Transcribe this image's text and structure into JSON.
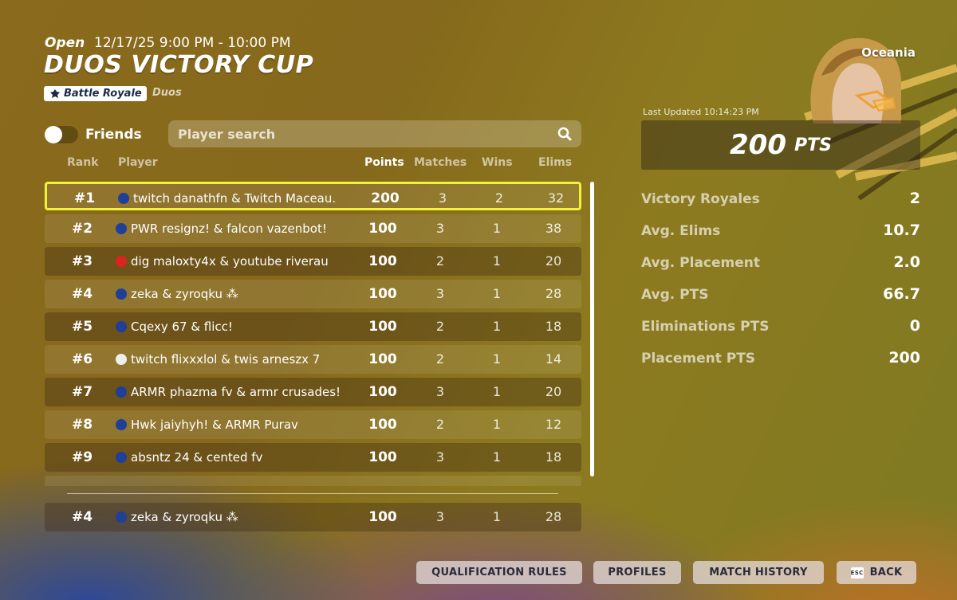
{
  "header": {
    "status": "Open",
    "time": "12/17/25 9:00 PM - 10:00 PM",
    "title": "DUOS VICTORY CUP",
    "mode": "Battle Royale",
    "team_type": "Duos"
  },
  "controls": {
    "friends_label": "Friends",
    "friends_toggle_on": false,
    "search_placeholder": "Player search"
  },
  "columns": {
    "rank": "Rank",
    "player": "Player",
    "points": "Points",
    "matches": "Matches",
    "wins": "Wins",
    "elims": "Elims"
  },
  "leaderboard": [
    {
      "rank": "#1",
      "player": "twitch danathfn & Twitch Maceau.",
      "flags": [
        "#1e3f9a",
        "#2a9d8f"
      ],
      "points": "200",
      "matches": "3",
      "wins": "2",
      "elims": "32"
    },
    {
      "rank": "#2",
      "player": "PWR resignz! & falcon vazenbot!",
      "flags": [
        "#1e3f9a",
        "#f2c200"
      ],
      "points": "100",
      "matches": "3",
      "wins": "1",
      "elims": "38"
    },
    {
      "rank": "#3",
      "player": "dig maloxty4x & youtube riverau",
      "flags": [
        "#d22",
        "#1e3f9a"
      ],
      "points": "100",
      "matches": "2",
      "wins": "1",
      "elims": "20"
    },
    {
      "rank": "#4",
      "player": "zeka & zyroqku ⁂",
      "flags": [
        "#1e3f9a",
        "#1e3f9a"
      ],
      "points": "100",
      "matches": "3",
      "wins": "1",
      "elims": "28"
    },
    {
      "rank": "#5",
      "player": "Cqexy 67 & flicc!",
      "flags": [
        "#1e3f9a",
        "#eee"
      ],
      "points": "100",
      "matches": "2",
      "wins": "1",
      "elims": "18"
    },
    {
      "rank": "#6",
      "player": "twitch flixxxlol & twis arneszx 7",
      "flags": [
        "#eee",
        "#e8b400"
      ],
      "points": "100",
      "matches": "2",
      "wins": "1",
      "elims": "14"
    },
    {
      "rank": "#7",
      "player": "ARMR phazma fv & armr crusades!",
      "flags": [
        "#1e3f9a",
        "#1e3f9a"
      ],
      "points": "100",
      "matches": "3",
      "wins": "1",
      "elims": "20"
    },
    {
      "rank": "#8",
      "player": "Hwk jaiyhyh! & ARMR Purav",
      "flags": [
        "#1e3f9a"
      ],
      "points": "100",
      "matches": "2",
      "wins": "1",
      "elims": "12"
    },
    {
      "rank": "#9",
      "player": "absntz 24 & cented fv",
      "flags": [
        "#1e3f9a",
        "#1e3f9a"
      ],
      "points": "100",
      "matches": "3",
      "wins": "1",
      "elims": "18"
    }
  ],
  "my_row": {
    "rank": "#4",
    "player": "zeka & zyroqku ⁂",
    "points": "100",
    "matches": "3",
    "wins": "1",
    "elims": "28"
  },
  "profile": {
    "region": "Oceania",
    "last_updated": "Last Updated 10:14:23 PM",
    "points": "200",
    "points_unit": "PTS",
    "stats": [
      {
        "label": "Victory Royales",
        "value": "2"
      },
      {
        "label": "Avg. Elims",
        "value": "10.7"
      },
      {
        "label": "Avg. Placement",
        "value": "2.0"
      },
      {
        "label": "Avg. PTS",
        "value": "66.7"
      },
      {
        "label": "Eliminations PTS",
        "value": "0"
      },
      {
        "label": "Placement PTS",
        "value": "200"
      }
    ]
  },
  "buttons": {
    "qualification_rules": "QUALIFICATION RULES",
    "profiles": "PROFILES",
    "match_history": "MATCH HISTORY",
    "esc_key": "ESC",
    "back": "BACK"
  },
  "colors": {
    "highlight": "#f2f23a",
    "accent_gold": "#8a6a1c"
  }
}
